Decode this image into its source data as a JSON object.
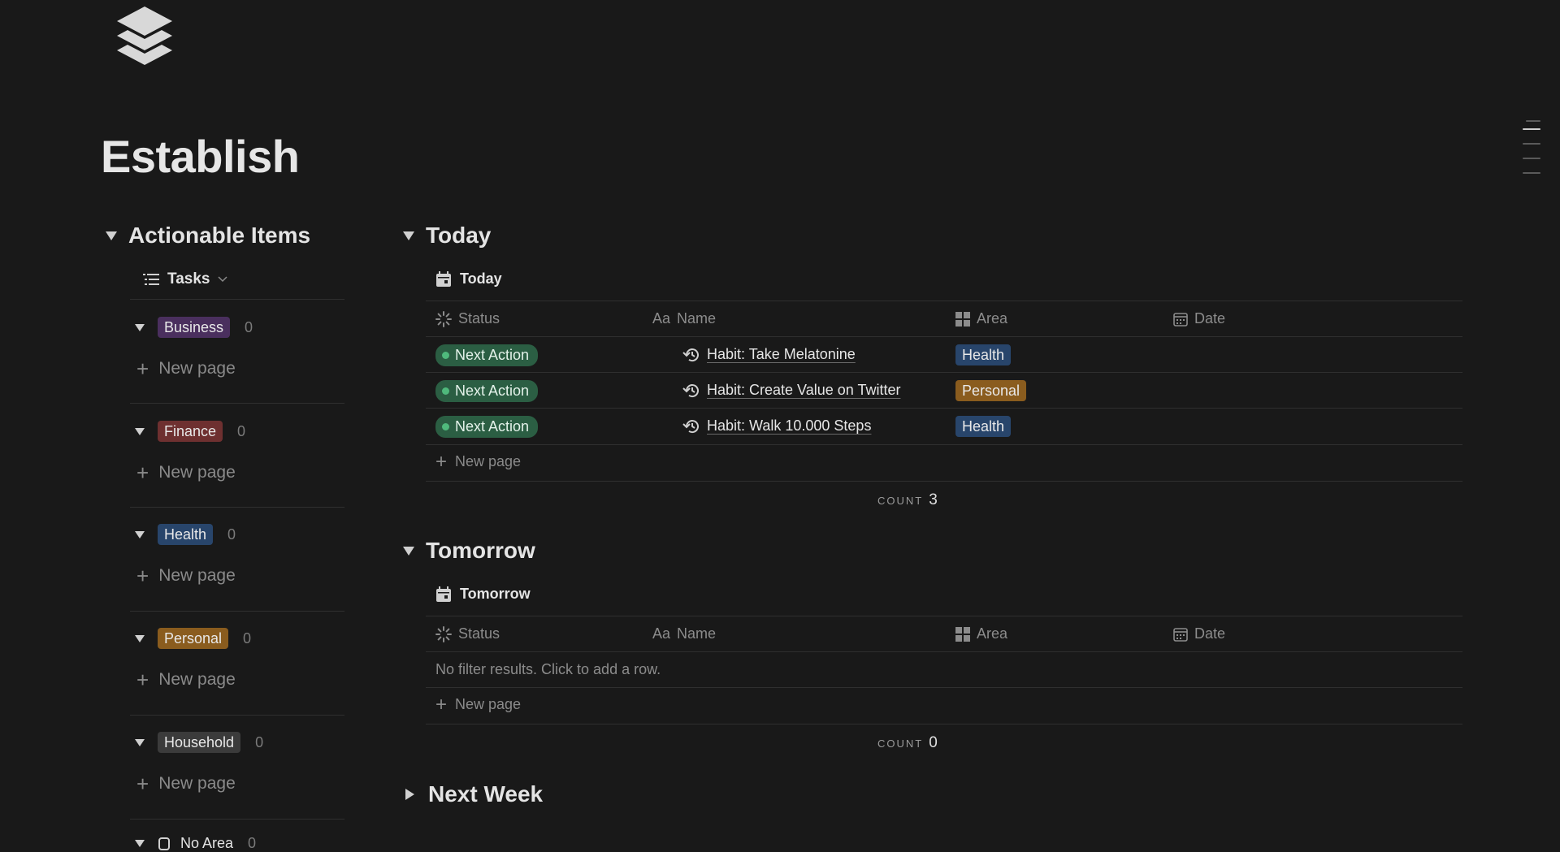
{
  "page": {
    "title": "Establish",
    "icon": "stack-layers-icon"
  },
  "left": {
    "section_title": "Actionable Items",
    "view_label": "Tasks",
    "new_page_label": "New page",
    "groups": [
      {
        "label": "Business",
        "count": "0",
        "color": "#4a2f5e"
      },
      {
        "label": "Finance",
        "count": "0",
        "color": "#6e3030"
      },
      {
        "label": "Health",
        "count": "0",
        "color": "#28456b"
      },
      {
        "label": "Personal",
        "count": "0",
        "color": "#8a5c1e"
      },
      {
        "label": "Household",
        "count": "0",
        "color": "#3b3b3b"
      },
      {
        "label": "No Area",
        "count": "0"
      }
    ]
  },
  "columns": {
    "status": "Status",
    "name_prefix": "Aa",
    "name": "Name",
    "area": "Area",
    "date": "Date"
  },
  "today": {
    "title": "Today",
    "view_label": "Today",
    "rows": [
      {
        "status": "Next Action",
        "name": "Habit: Take Melatonine",
        "area": "Health"
      },
      {
        "status": "Next Action",
        "name": "Habit: Create Value on Twitter",
        "area": "Personal"
      },
      {
        "status": "Next Action",
        "name": "Habit: Walk 10.000 Steps",
        "area": "Health"
      }
    ],
    "new_page_label": "New page",
    "count_label": "COUNT",
    "count_value": "3"
  },
  "tomorrow": {
    "title": "Tomorrow",
    "view_label": "Tomorrow",
    "empty_text": "No filter results. Click to add a row.",
    "new_page_label": "New page",
    "count_label": "COUNT",
    "count_value": "0"
  },
  "next_week": {
    "title": "Next Week"
  },
  "colors": {
    "background": "#191919",
    "status_green": "#2b5e43",
    "health": "#28456b",
    "personal": "#8a5c1e"
  }
}
